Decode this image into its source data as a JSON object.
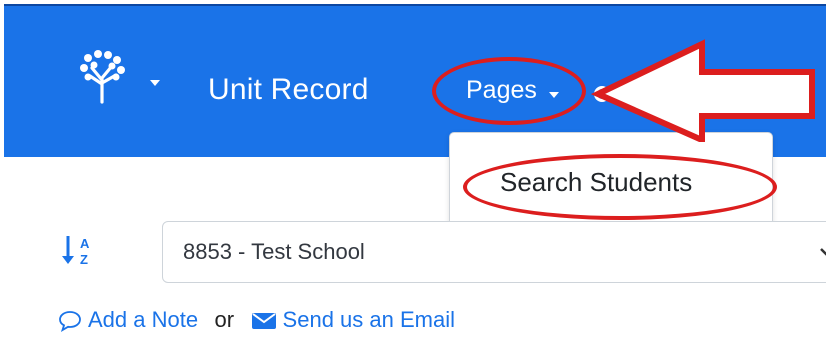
{
  "navbar": {
    "brand_icon": "tree-logo-icon",
    "title": "Unit Record",
    "pages_label": "Pages",
    "background": "#1a73e8"
  },
  "dropdown": {
    "items": [
      {
        "label": "Search Students"
      }
    ]
  },
  "filter": {
    "sort_icon": "sort-alpha-down-icon",
    "school_select": {
      "value": "8853 - Test School"
    }
  },
  "actions": {
    "add_note_label": "Add a Note",
    "or_text": "or",
    "email_label": "Send us an Email",
    "link_color": "#1a73e8"
  },
  "annotations": {
    "highlight_color": "#dc1e1e"
  }
}
